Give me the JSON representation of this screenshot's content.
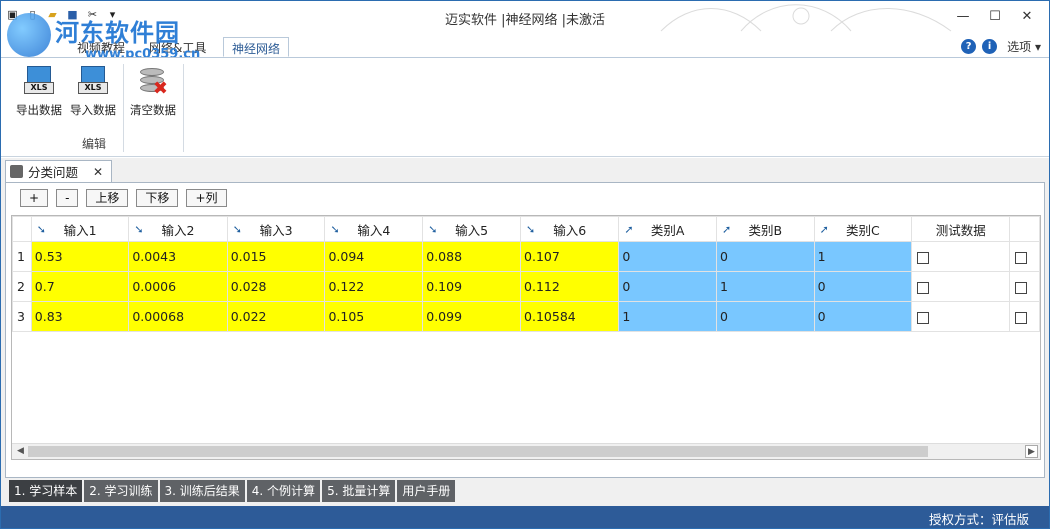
{
  "window": {
    "title": "迈实软件 |神经网络 |未激活",
    "controls": [
      "minimize",
      "maximize",
      "close"
    ]
  },
  "watermark": {
    "name": "河东软件园",
    "url": "www.pc0359.cn"
  },
  "ribbon": {
    "tabs": [
      {
        "label": "视频教程"
      },
      {
        "label": "网络&工具"
      },
      {
        "label": "神经网络",
        "active": true
      }
    ],
    "options_label": "选项",
    "buttons": {
      "export": "导出数据",
      "import": "导入数据",
      "clear": "清空数据"
    },
    "xls_label": "XLS",
    "group_label": "编辑"
  },
  "document": {
    "tab_label": "分类问题",
    "toolbar": {
      "add": "+",
      "remove": "-",
      "move_up": "上移",
      "move_down": "下移",
      "add_column": "+列"
    },
    "grid": {
      "columns": [
        "输入1",
        "输入2",
        "输入3",
        "输入4",
        "输入5",
        "输入6",
        "类别A",
        "类别B",
        "类别C",
        "测试数据"
      ],
      "rows": [
        {
          "n": "1",
          "cells": [
            "0.53",
            "0.0043",
            "0.015",
            "0.094",
            "0.088",
            "0.107",
            "0",
            "0",
            "1"
          ]
        },
        {
          "n": "2",
          "cells": [
            "0.7",
            "0.0006",
            "0.028",
            "0.122",
            "0.109",
            "0.112",
            "0",
            "1",
            "0"
          ]
        },
        {
          "n": "3",
          "cells": [
            "0.83",
            "0.00068",
            "0.022",
            "0.105",
            "0.099",
            "0.10584",
            "1",
            "0",
            "0"
          ]
        }
      ]
    }
  },
  "bottom_tabs": [
    {
      "label": "1. 学习样本",
      "active": true
    },
    {
      "label": "2. 学习训练"
    },
    {
      "label": "3. 训练后结果"
    },
    {
      "label": "4. 个例计算"
    },
    {
      "label": "5. 批量计算"
    },
    {
      "label": "用户手册"
    }
  ],
  "status": {
    "license": "授权方式：评估版"
  },
  "colors": {
    "input_cell": "#ffff00",
    "output_cell": "#79c7ff",
    "status_bar": "#2d5b98"
  }
}
